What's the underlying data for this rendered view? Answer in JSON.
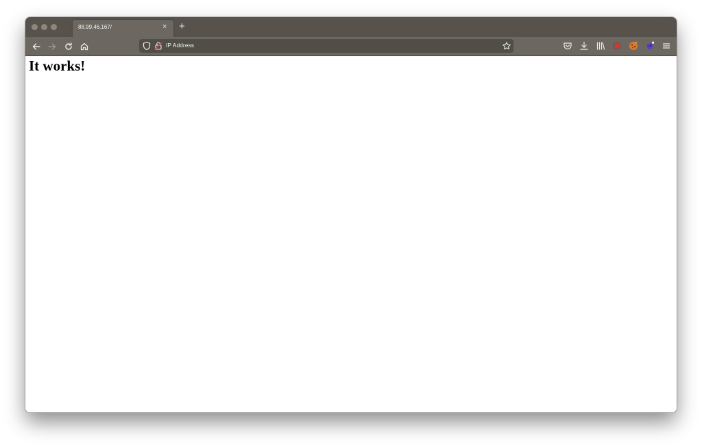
{
  "browser": {
    "tab": {
      "title": "88.99.46.167/",
      "close_glyph": "×"
    },
    "new_tab_glyph": "+",
    "url_bar": {
      "text": "IP Address"
    },
    "colors": {
      "titlebar": "#57534c",
      "toolbar": "#6c6861",
      "url_bar": "#514e48",
      "red_extension": "#d8342c"
    },
    "icons": [
      "back-icon",
      "forward-icon",
      "reload-icon",
      "home-icon",
      "shield-icon",
      "lock-warning-icon",
      "bookmark-star-icon",
      "pocket-icon",
      "download-icon",
      "library-icon",
      "extension-red-icon",
      "extension-cookie-icon",
      "extension-puzzle-icon",
      "menu-icon"
    ]
  },
  "page": {
    "heading": "It works!"
  }
}
